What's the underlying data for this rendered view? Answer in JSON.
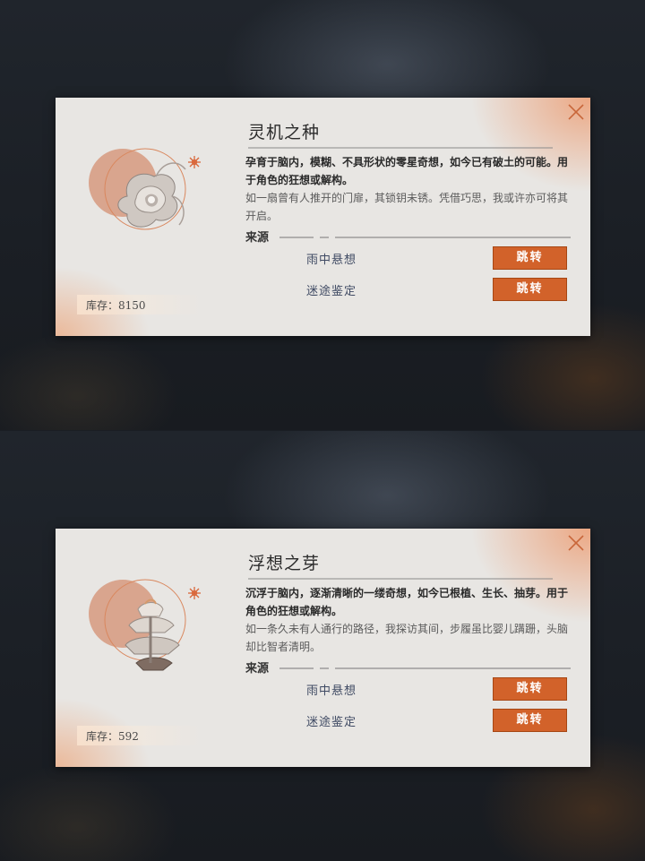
{
  "cards": [
    {
      "title": "灵机之种",
      "desc_main": "孕育于脑内，模糊、不具形状的零星奇想，如今已有破土的可能。用于角色的狂想或解构。",
      "desc_sub": "如一扇曾有人推开的门扉，其锁钥未锈。凭借巧思，我或许亦可将其开启。",
      "source_label": "来源",
      "sources": [
        {
          "name": "雨中悬想",
          "button": "跳转"
        },
        {
          "name": "迷途鉴定",
          "button": "跳转"
        }
      ],
      "stock": "库存：8150",
      "item_icon": "seed-flower-icon"
    },
    {
      "title": "浮想之芽",
      "desc_main": "沉浮于脑内，逐渐清晰的一缕奇想，如今已根植、生长、抽芽。用于角色的狂想或解构。",
      "desc_sub": "如一条久未有人通行的路径，我探访其间，步履虽比婴儿蹒跚，头脑却比智者清明。",
      "source_label": "来源",
      "sources": [
        {
          "name": "雨中悬想",
          "button": "跳转"
        },
        {
          "name": "迷途鉴定",
          "button": "跳转"
        }
      ],
      "stock": "库存：592",
      "item_icon": "sprout-crystal-icon"
    }
  ],
  "colors": {
    "accent": "#d2622a",
    "panel": "#e8e6e3",
    "glow": "#eca078"
  }
}
